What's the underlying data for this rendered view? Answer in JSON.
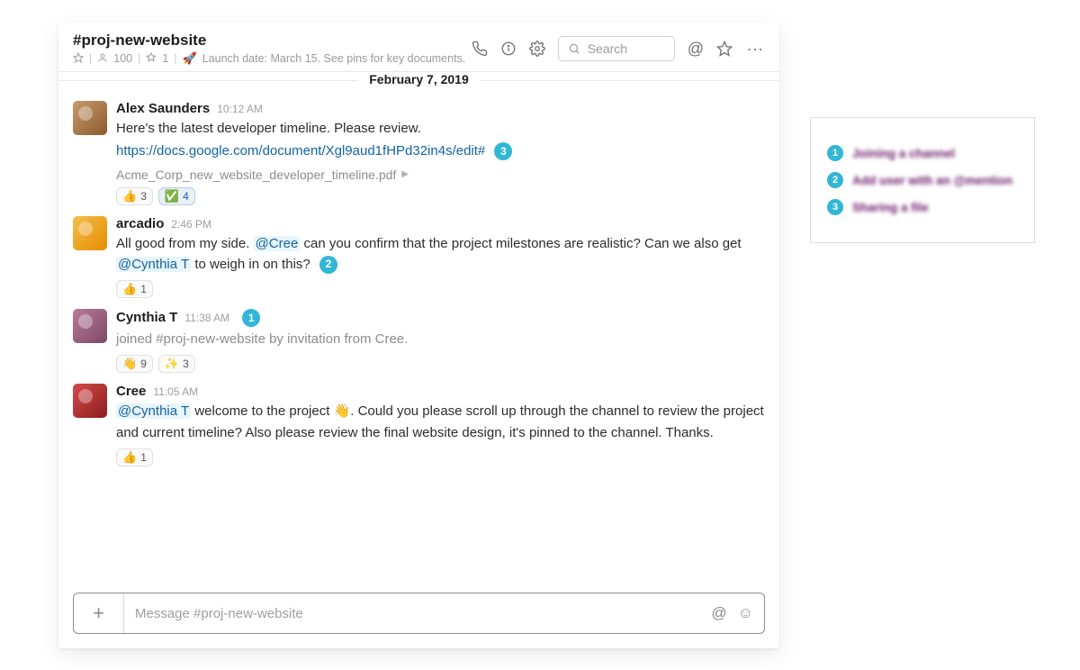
{
  "channel": {
    "name": "#proj-new-website",
    "members": "100",
    "pins": "1",
    "topic": "Launch date: March 15. See pins for key documents."
  },
  "toolbar": {
    "search_placeholder": "Search"
  },
  "date_divider": "February 7, 2019",
  "badges": {
    "b1": "1",
    "b2": "2",
    "b3": "3"
  },
  "messages": {
    "m1": {
      "author": "Alex Saunders",
      "time": "10:12 AM",
      "text": "Here's the latest developer timeline. Please review.",
      "link": "https://docs.google.com/document/Xgl9aud1fHPd32in4s/edit#",
      "attachment": "Acme_Corp_new_website_developer_timeline.pdf",
      "reactions": {
        "r1_count": "3",
        "r2_count": "4"
      }
    },
    "m2": {
      "author": "arcadio",
      "time": "2:46 PM",
      "pre": "All good from my side. ",
      "mention1": "@Cree",
      "mid": " can you confirm that the project milestones are realistic? Can we also get ",
      "mention2": "@Cynthia T",
      "post": " to weigh in on this?",
      "reactions": {
        "r1_count": "1"
      }
    },
    "m3": {
      "author": "Cynthia T",
      "time": "11:38 AM",
      "text": "joined #proj-new-website by invitation from Cree.",
      "reactions": {
        "r1_count": "9",
        "r2_count": "3"
      }
    },
    "m4": {
      "author": "Cree",
      "time": "11:05 AM",
      "mention": "@Cynthia T",
      "pre": " welcome to the project ",
      "post": ". Could you please scroll up through the channel to review the project and current timeline? Also please review the final website design, it's pinned to the channel. Thanks.",
      "reactions": {
        "r1_count": "1"
      }
    }
  },
  "composer": {
    "placeholder": "Message #proj-new-website"
  },
  "legend": {
    "i1": "Joining a channel",
    "i2": "Add user with an @mention",
    "i3": "Sharing a file"
  }
}
